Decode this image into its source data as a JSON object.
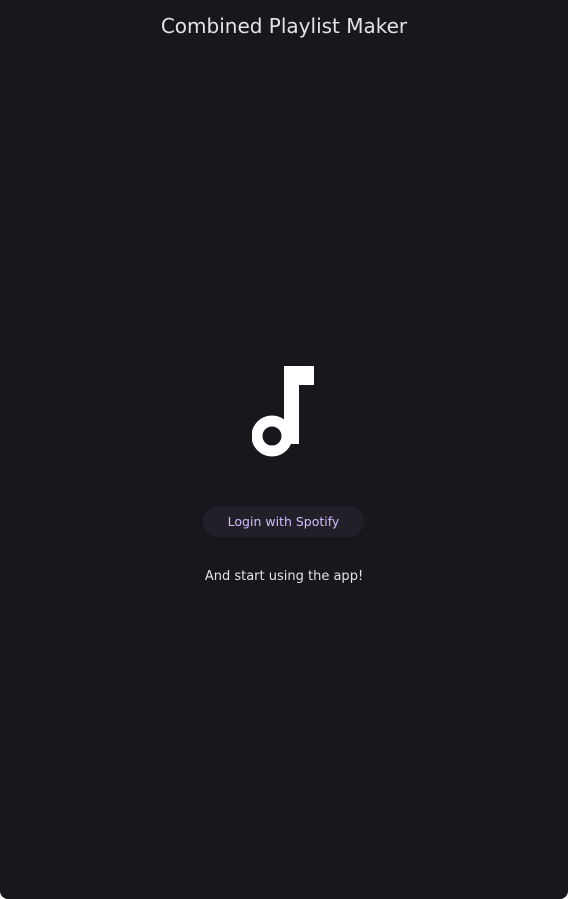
{
  "app": {
    "title": "Combined Playlist Maker"
  },
  "hero": {
    "icon": "music-note-icon",
    "login_label": "Login with Spotify",
    "subtitle": "And start using the app!"
  },
  "colors": {
    "background": "#18171c",
    "title_text": "#e6e1e6",
    "button_background": "#221f29",
    "button_text": "#cfbcff",
    "icon": "#ffffff"
  }
}
